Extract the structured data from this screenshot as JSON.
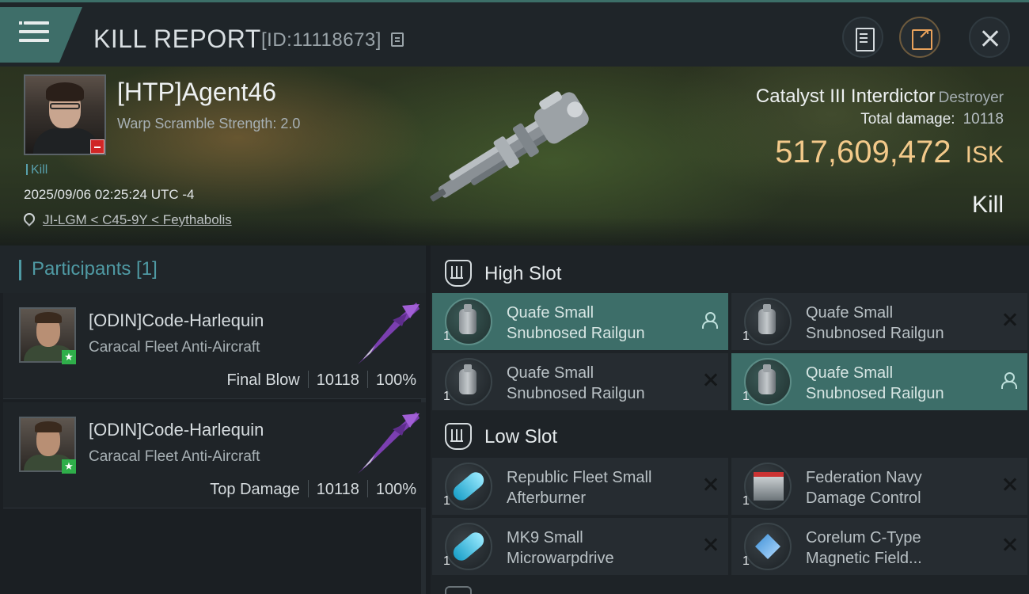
{
  "header": {
    "title": "KILL REPORT",
    "report_id": "[ID:11118673]"
  },
  "victim": {
    "name": "[HTP]Agent46",
    "scram_text": "Warp Scramble Strength: 2.0",
    "kill_tag": "Kill",
    "timestamp": "2025/09/06 02:25:24 UTC -4",
    "location": "JI-LGM < C45-9Y < Feythabolis",
    "ship_name": "Catalyst III Interdictor",
    "ship_class": "Destroyer",
    "total_damage_label": "Total damage:",
    "total_damage": "10118",
    "isk_value": "517,609,472",
    "isk_unit": "ISK",
    "result": "Kill"
  },
  "participants": {
    "title": "Participants [1]",
    "cards": [
      {
        "name": "[ODIN]Code-Harlequin",
        "ship": "Caracal Fleet Anti-Aircraft",
        "role": "Final Blow",
        "damage": "10118",
        "percent": "100%"
      },
      {
        "name": "[ODIN]Code-Harlequin",
        "ship": "Caracal Fleet Anti-Aircraft",
        "role": "Top Damage",
        "damage": "10118",
        "percent": "100%"
      }
    ]
  },
  "fitting": {
    "high_slot_label": "High Slot",
    "low_slot_label": "Low Slot",
    "high": [
      {
        "qty": "1",
        "line1": "Quafe Small",
        "line2": "Snubnosed Railgun"
      },
      {
        "qty": "1",
        "line1": "Quafe Small",
        "line2": "Snubnosed Railgun"
      },
      {
        "qty": "1",
        "line1": "Quafe Small",
        "line2": "Snubnosed Railgun"
      },
      {
        "qty": "1",
        "line1": "Quafe Small",
        "line2": "Snubnosed Railgun"
      }
    ],
    "low": [
      {
        "qty": "1",
        "line1": "Republic Fleet Small",
        "line2": "Afterburner"
      },
      {
        "qty": "1",
        "line1": "Federation Navy",
        "line2": "Damage Control"
      },
      {
        "qty": "1",
        "line1": "MK9 Small",
        "line2": "Microwarpdrive"
      },
      {
        "qty": "1",
        "line1": "Corelum C-Type",
        "line2": "Magnetic Field..."
      }
    ]
  },
  "colors": {
    "accent": "#3e6e69",
    "isk": "#f3c98a",
    "kill_tag": "#58a0ad",
    "badge_red": "#d02626"
  }
}
